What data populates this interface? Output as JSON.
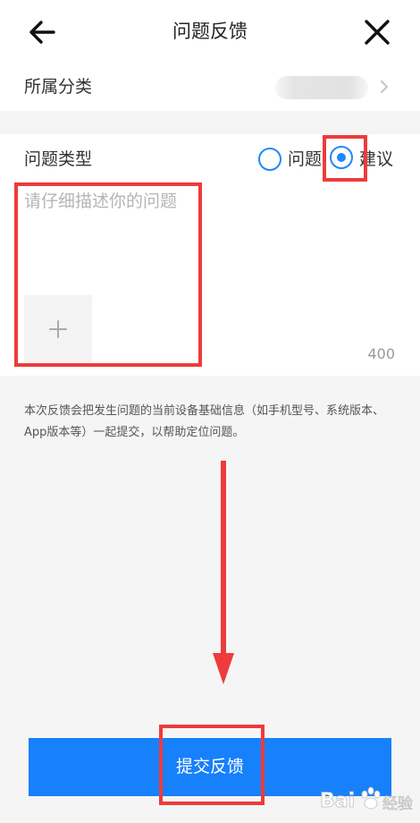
{
  "header": {
    "title": "问题反馈",
    "back_icon": "arrow-left-icon",
    "close_icon": "close-icon"
  },
  "category": {
    "label": "所属分类",
    "value_blurred": true,
    "chevron_icon": "chevron-right-icon"
  },
  "type_section": {
    "label": "问题类型",
    "options": [
      {
        "label": "问题",
        "selected": false
      },
      {
        "label": "建议",
        "selected": true
      }
    ]
  },
  "description": {
    "placeholder": "请仔细描述你的问题",
    "value": "",
    "add_image_icon": "plus-icon",
    "char_limit": "400"
  },
  "notice": "本次反馈会把发生问题的当前设备基础信息（如手机型号、系统版本、App版本等）一起提交，以帮助定位问题。",
  "submit_label": "提交反馈",
  "colors": {
    "accent": "#1780fb",
    "radio": "#1e88ff",
    "annotation": "#ee3b3b",
    "page_bg": "#f5f5f5"
  },
  "watermark_text": "Bai 经验"
}
